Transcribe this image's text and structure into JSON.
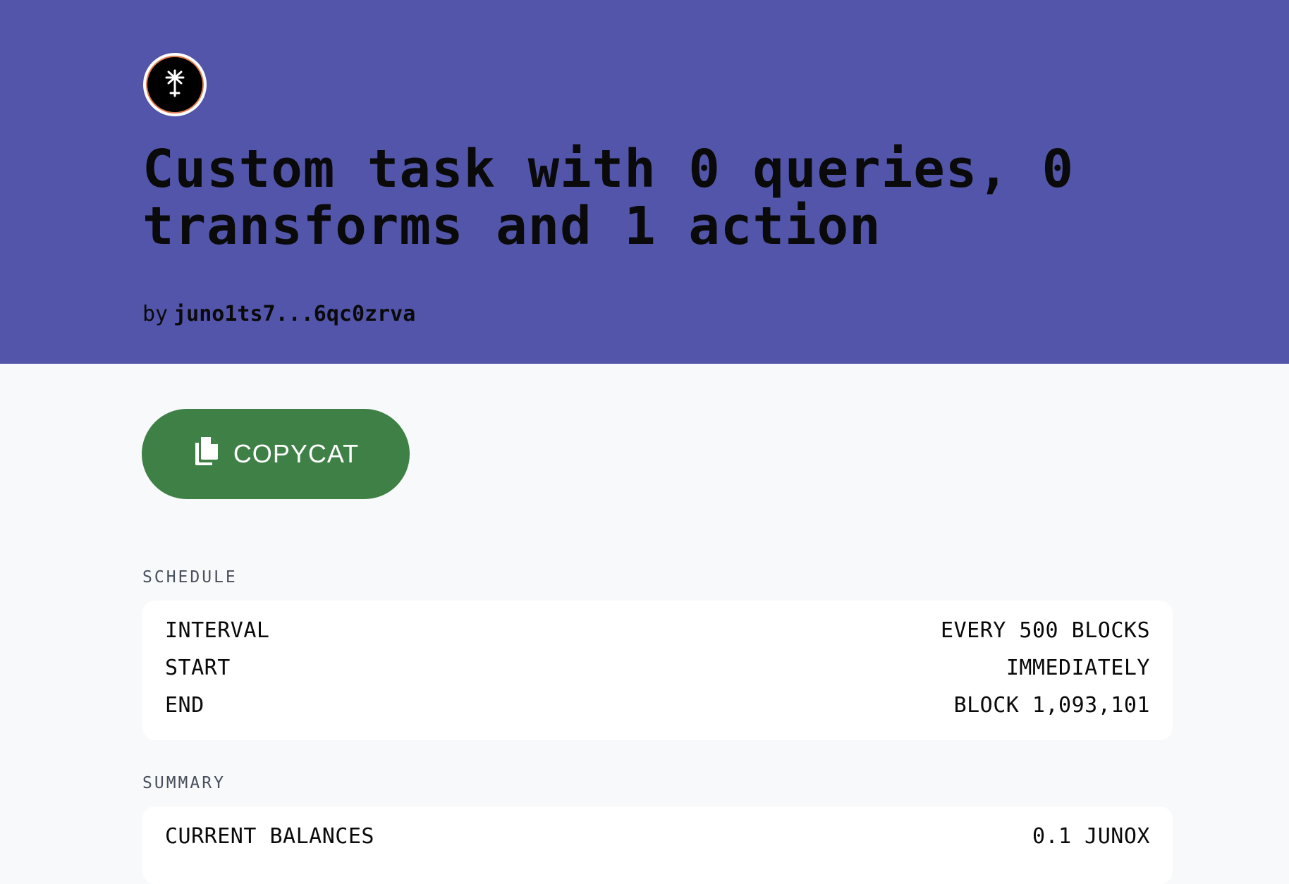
{
  "header": {
    "title": "Custom task with 0 queries, 0 transforms and 1 action",
    "by_label": "by",
    "author": "juno1ts7...6qc0zrva",
    "avatar_icon": "juno-logo-icon",
    "background_color": "#5255aa"
  },
  "actions": {
    "copycat_label": "COPYCAT",
    "copycat_icon": "copy-icon",
    "copycat_color": "#3f8046"
  },
  "schedule": {
    "label": "SCHEDULE",
    "rows": [
      {
        "key": "INTERVAL",
        "value": "EVERY 500 BLOCKS"
      },
      {
        "key": "START",
        "value": "IMMEDIATELY"
      },
      {
        "key": "END",
        "value": "BLOCK 1,093,101"
      }
    ]
  },
  "summary": {
    "label": "SUMMARY",
    "rows": [
      {
        "key": "CURRENT BALANCES",
        "value": "0.1 JUNOX"
      }
    ]
  }
}
